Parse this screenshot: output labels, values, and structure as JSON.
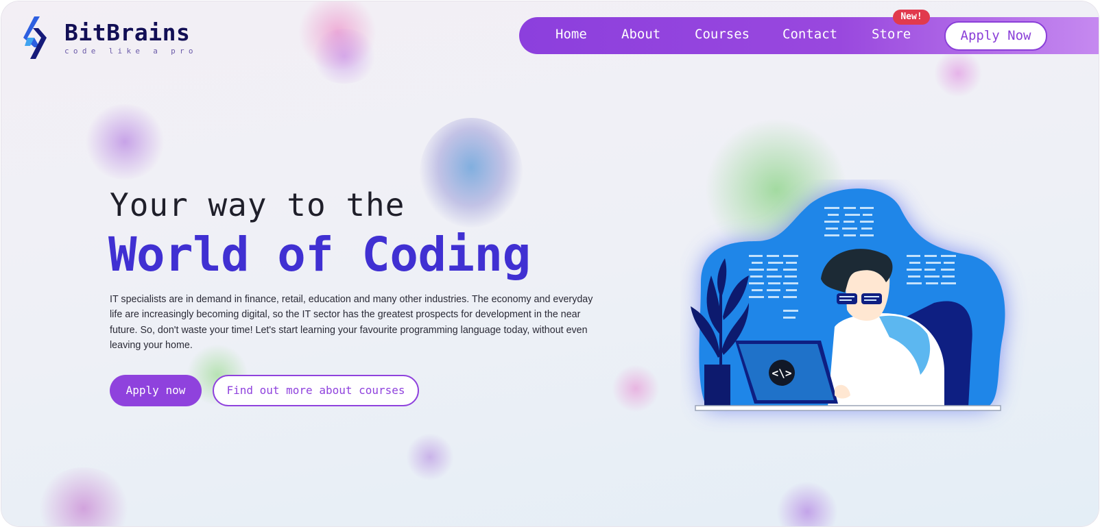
{
  "brand": {
    "name": "BitBrains",
    "tagline": "code like a pro",
    "icon": "chevron-brackets-logo-icon"
  },
  "nav": {
    "items": [
      {
        "label": "Home"
      },
      {
        "label": "About"
      },
      {
        "label": "Courses"
      },
      {
        "label": "Contact"
      },
      {
        "label": "Store"
      }
    ],
    "store_badge": "New!",
    "apply_label": "Apply Now"
  },
  "hero": {
    "title_line1": "Your way to the",
    "title_line2": "World of Coding",
    "description": "IT specialists are in demand in finance, retail, education and many other industries. The economy and everyday life are increasingly becoming digital, so the IT sector has the greatest prospects for development in the near future. So, don't waste your time! Let's start learning your favourite programming language today, without even leaving your home.",
    "primary_button": "Apply now",
    "secondary_button": "Find out more about courses"
  },
  "illustration": {
    "laptop_symbol": "<\\>",
    "icon": "programmer-at-laptop-illustration"
  },
  "colors": {
    "accent_purple": "#8f42dd",
    "title_blue": "#4030d2",
    "brand_navy": "#120f55",
    "badge_red": "#e13a4d",
    "illustration_blue": "#1e7fe0"
  }
}
